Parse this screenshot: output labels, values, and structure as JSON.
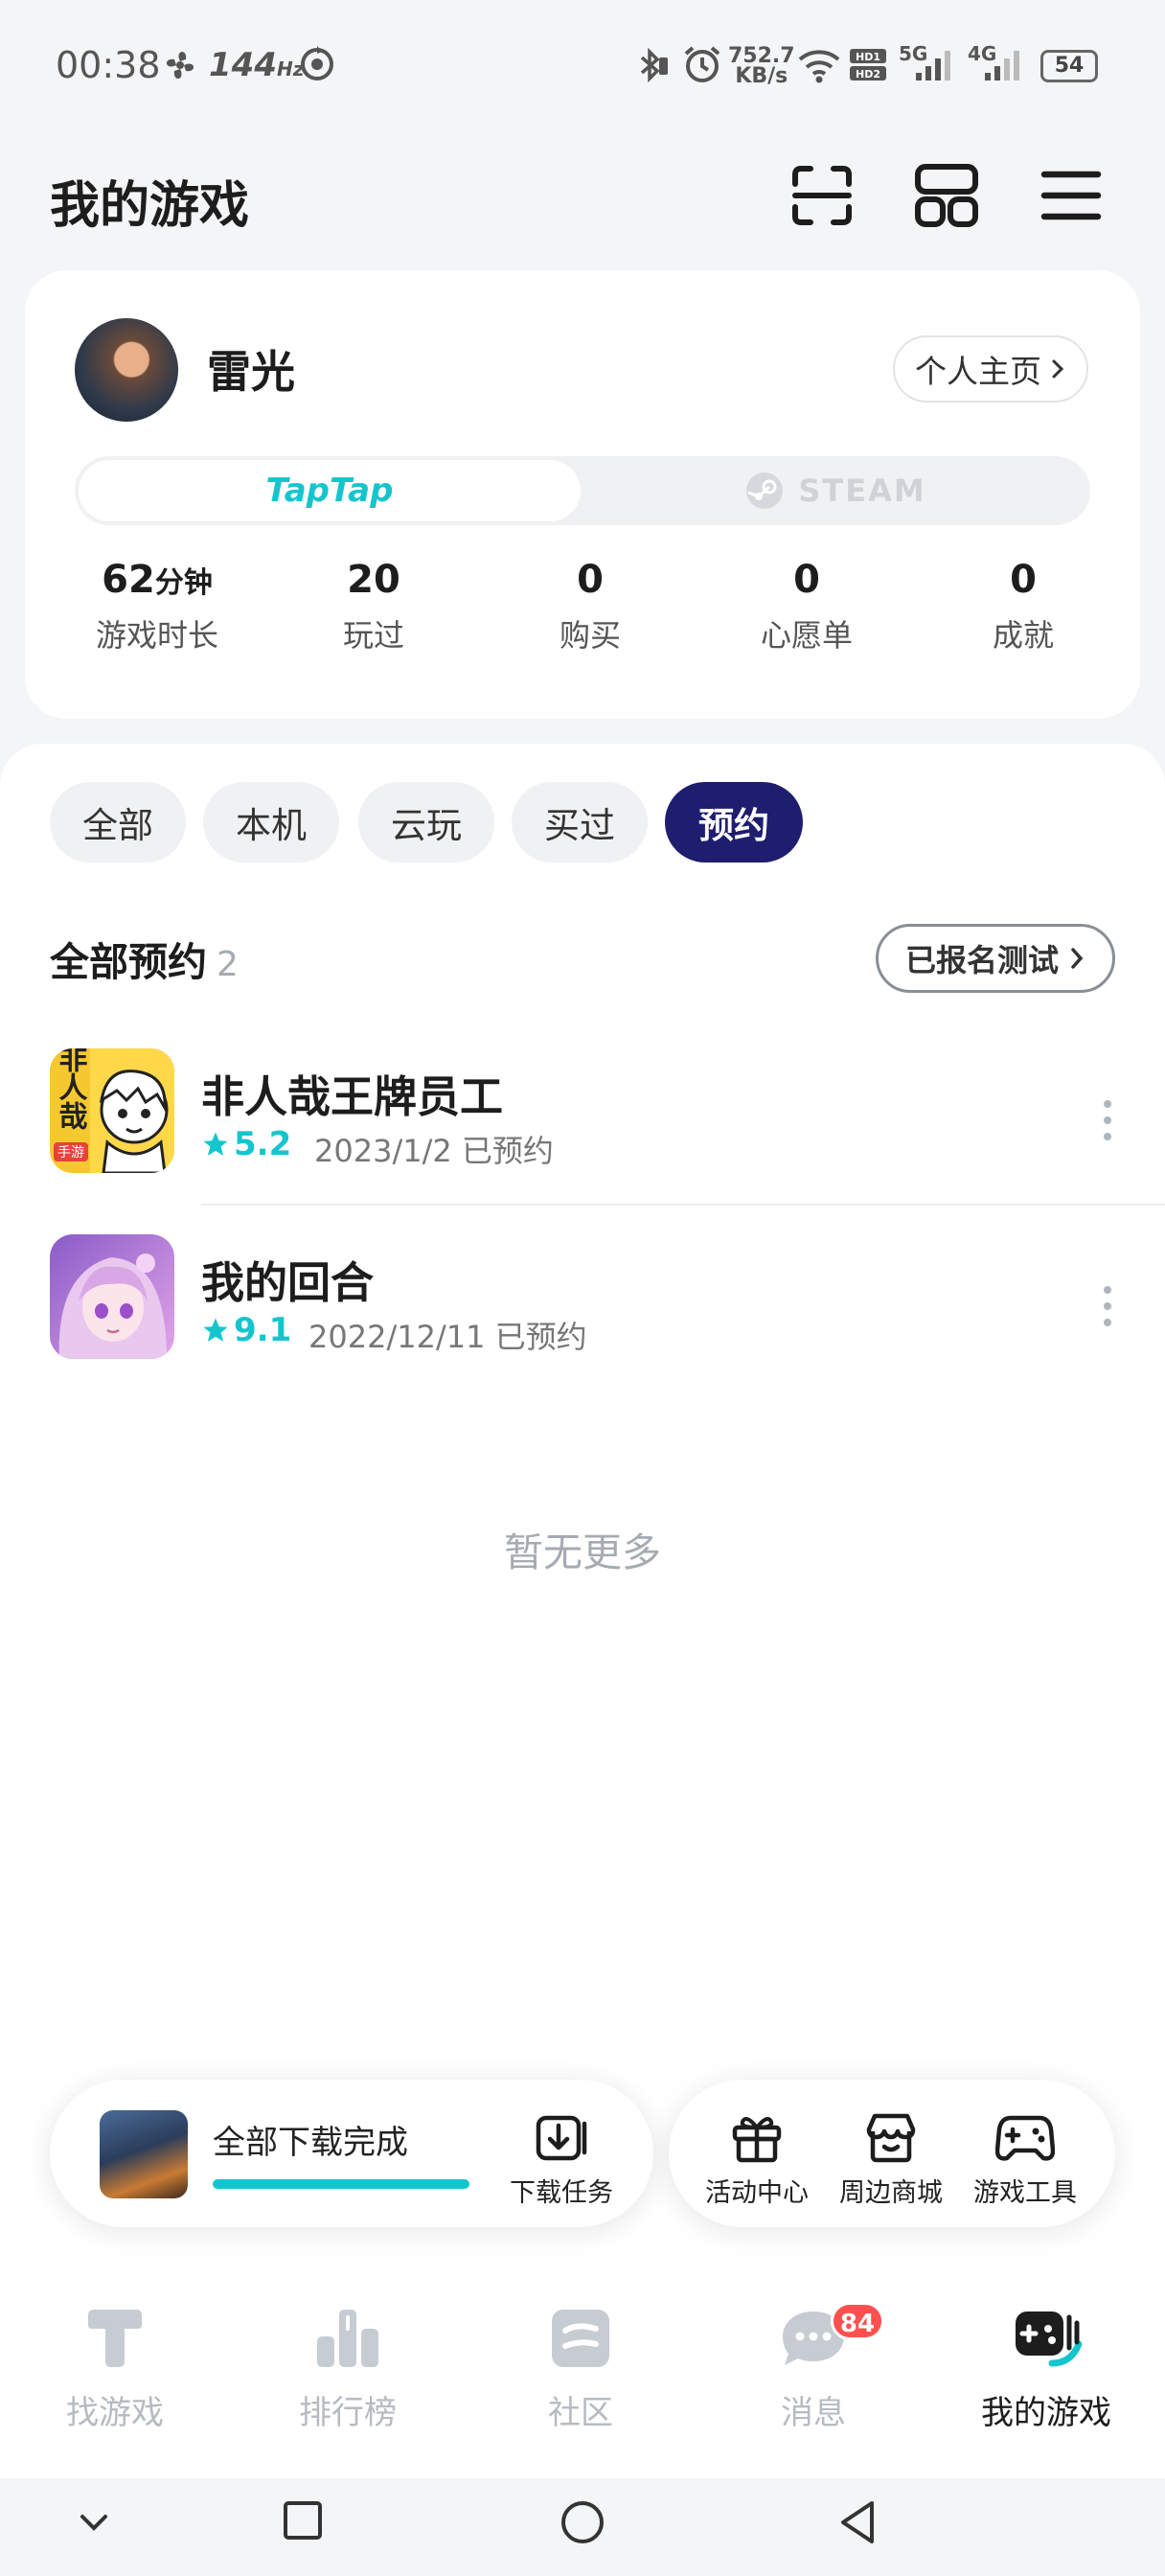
{
  "status_bar": {
    "time": "00:38",
    "refresh_rate": "144",
    "refresh_unit": "Hz",
    "net_speed_value": "752.7",
    "net_speed_unit": "KB/s",
    "sim1_label": "5G",
    "sim2_label": "4G",
    "battery": "54"
  },
  "header": {
    "title": "我的游戏",
    "icons": [
      "scan-icon",
      "grid-icon",
      "menu-icon"
    ]
  },
  "profile": {
    "username": "雷光",
    "homepage_label": "个人主页",
    "platform_tabs": [
      {
        "label": "TapTap",
        "active": true
      },
      {
        "label": "STEAM",
        "active": false
      }
    ],
    "stats": [
      {
        "value": "62",
        "unit": "分钟",
        "label": "游戏时长"
      },
      {
        "value": "20",
        "unit": "",
        "label": "玩过"
      },
      {
        "value": "0",
        "unit": "",
        "label": "购买"
      },
      {
        "value": "0",
        "unit": "",
        "label": "心愿单"
      },
      {
        "value": "0",
        "unit": "",
        "label": "成就"
      }
    ]
  },
  "filters": [
    {
      "label": "全部",
      "active": false
    },
    {
      "label": "本机",
      "active": false
    },
    {
      "label": "云玩",
      "active": false
    },
    {
      "label": "买过",
      "active": false
    },
    {
      "label": "预约",
      "active": true
    }
  ],
  "section": {
    "title": "全部预约",
    "count": "2",
    "signup_label": "已报名测试"
  },
  "games": [
    {
      "name": "非人哉王牌员工",
      "rating": "5.2",
      "date": "2023/1/2 已预约",
      "icon_text": "非人哉",
      "icon_tag": "手游"
    },
    {
      "name": "我的回合",
      "rating": "9.1",
      "date": "2022/12/11 已预约"
    }
  ],
  "empty_hint": "暂无更多",
  "download": {
    "status": "全部下载完成",
    "progress": 1.0,
    "task_label": "下载任务"
  },
  "tools": [
    {
      "label": "活动中心",
      "icon": "gift-icon"
    },
    {
      "label": "周边商城",
      "icon": "shop-icon"
    },
    {
      "label": "游戏工具",
      "icon": "gamepad-icon"
    }
  ],
  "bottom_nav": [
    {
      "label": "找游戏",
      "icon": "discover-icon",
      "active": false
    },
    {
      "label": "排行榜",
      "icon": "ranking-icon",
      "active": false
    },
    {
      "label": "社区",
      "icon": "community-icon",
      "active": false
    },
    {
      "label": "消息",
      "icon": "message-icon",
      "active": false,
      "badge": "84"
    },
    {
      "label": "我的游戏",
      "icon": "my-games-icon",
      "active": true
    }
  ],
  "colors": {
    "accent": "#15c5ce",
    "active_chip": "#1f1d6e",
    "badge": "#ff4f4f"
  }
}
